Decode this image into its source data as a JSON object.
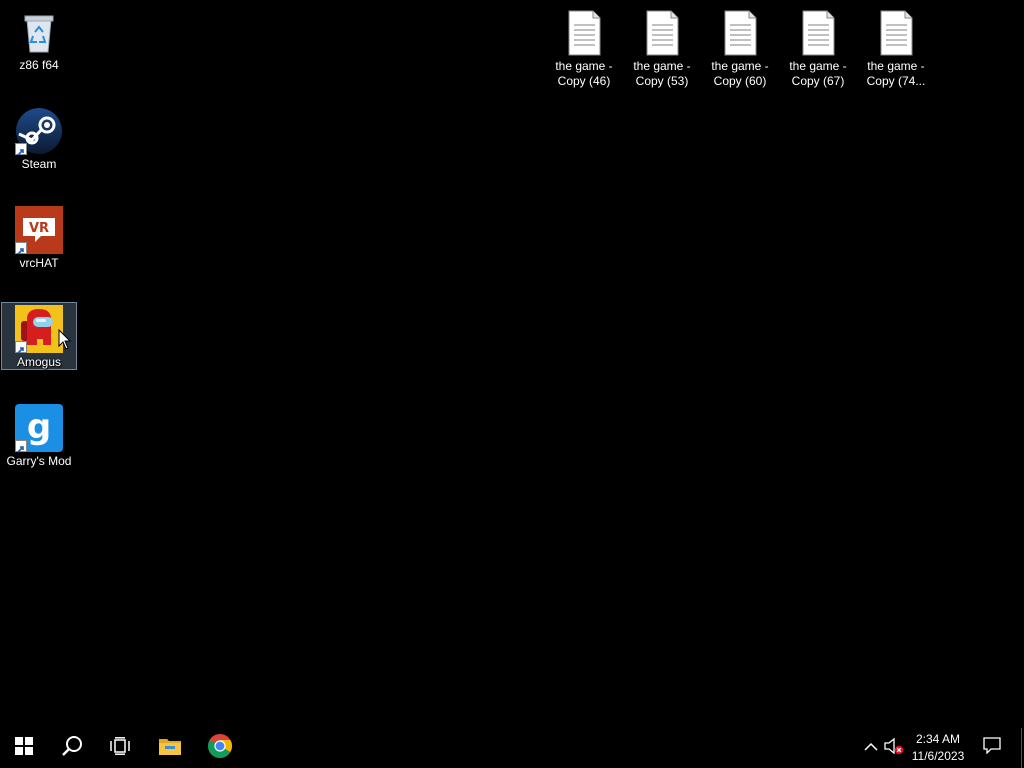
{
  "desktop": {
    "icons_left": [
      {
        "label": "z86 f64",
        "icon": "recycle-bin-icon"
      },
      {
        "label": "Steam",
        "icon": "steam-icon"
      },
      {
        "label": "vrcHAT",
        "icon": "vrchat-icon"
      },
      {
        "label": "Amogus",
        "icon": "among-us-icon",
        "selected": true
      },
      {
        "label": "Garry's Mod",
        "icon": "garrys-mod-icon"
      }
    ],
    "files_top": [
      {
        "label": "the game -\nCopy (46)"
      },
      {
        "label": "the game -\nCopy (53)"
      },
      {
        "label": "the game -\nCopy (60)"
      },
      {
        "label": "the game -\nCopy (67)"
      },
      {
        "label": "the game -\nCopy (74..."
      }
    ]
  },
  "taskbar": {
    "buttons": [
      "windows-start-icon",
      "search-icon",
      "task-view-icon",
      "file-explorer-icon",
      "chrome-icon"
    ],
    "tray": {
      "time": "2:34 AM",
      "date": "11/6/2023",
      "icons": [
        "chevron-up-icon",
        "speaker-muted-icon",
        "notification-icon"
      ]
    }
  },
  "colors": {
    "desktop_bg": "#000000",
    "steam_blue": "#1b3f73",
    "vrchat_red": "#b83a1b",
    "amogus_red": "#d71e1e",
    "amogus_yellow": "#f2c21a",
    "gmod_blue": "#1a8fe3",
    "explorer_yellow": "#f5c542"
  }
}
